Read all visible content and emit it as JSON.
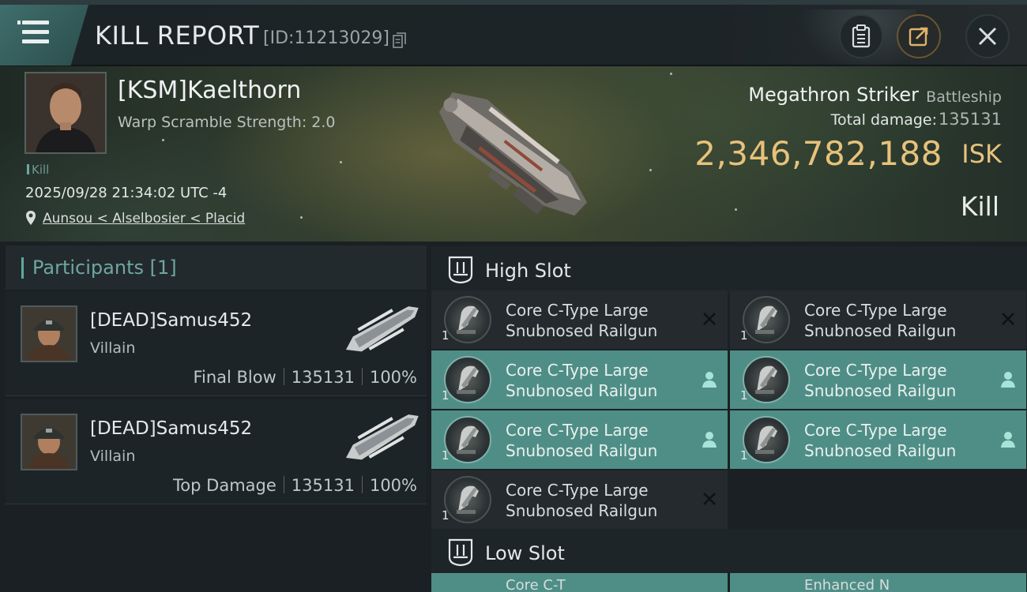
{
  "header": {
    "title": "KILL REPORT",
    "report_id": "[ID:11213029]",
    "icons": [
      "menu-icon",
      "copy-icon",
      "clipboard-icon",
      "share-icon",
      "close-icon"
    ]
  },
  "victim": {
    "name": "[KSM]Kaelthorn",
    "warp_scramble": "Warp Scramble Strength: 2.0",
    "tag": "Kill",
    "timestamp": "2025/09/28 21:34:02 UTC -4",
    "location": "Aunsou < Alselbosier < Placid"
  },
  "ship": {
    "name": "Megathron Striker",
    "class": "Battleship",
    "total_damage_label": "Total damage:",
    "total_damage": "135131",
    "isk_value": "2,346,782,188",
    "isk_label": "ISK",
    "result": "Kill"
  },
  "participants": {
    "header": "Participants [1]",
    "rows": [
      {
        "name": "[DEAD]Samus452",
        "role": "Villain",
        "stat_label": "Final Blow",
        "damage": "135131",
        "percent": "100%"
      },
      {
        "name": "[DEAD]Samus452",
        "role": "Villain",
        "stat_label": "Top Damage",
        "damage": "135131",
        "percent": "100%"
      }
    ]
  },
  "slots": {
    "high": {
      "title": "High Slot",
      "modules": [
        {
          "name": "Core C-Type Large Snubnosed Railgun",
          "qty": "1",
          "state": "destroyed"
        },
        {
          "name": "Core C-Type Large Snubnosed Railgun",
          "qty": "1",
          "state": "destroyed"
        },
        {
          "name": "Core C-Type Large Snubnosed Railgun",
          "qty": "1",
          "state": "dropped"
        },
        {
          "name": "Core C-Type Large Snubnosed Railgun",
          "qty": "1",
          "state": "dropped"
        },
        {
          "name": "Core C-Type Large Snubnosed Railgun",
          "qty": "1",
          "state": "dropped"
        },
        {
          "name": "Core C-Type Large Snubnosed Railgun",
          "qty": "1",
          "state": "dropped"
        },
        {
          "name": "Core C-Type Large Snubnosed Railgun",
          "qty": "1",
          "state": "destroyed"
        }
      ]
    },
    "low": {
      "title": "Low Slot",
      "peek_modules": [
        {
          "name": "Core C-T"
        },
        {
          "name": "Enhanced N"
        }
      ]
    }
  },
  "colors": {
    "accent": "#4f8e86",
    "isk_gold": "#e7c27a",
    "panel": "#1a2023"
  }
}
